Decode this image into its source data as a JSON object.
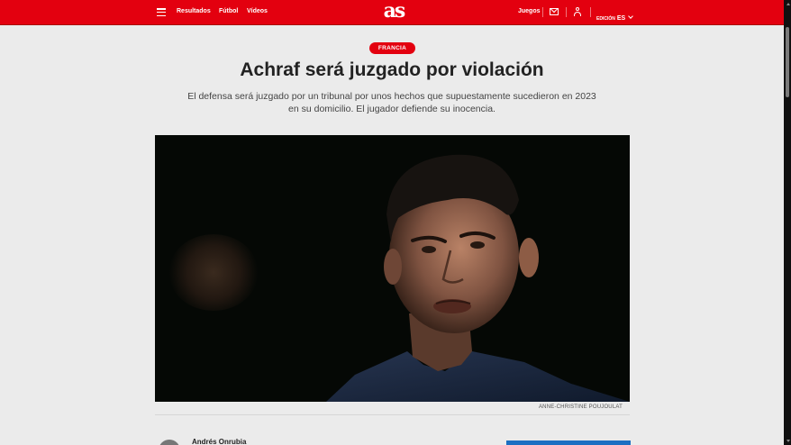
{
  "header": {
    "logo": "as",
    "nav": [
      "Resultados",
      "Fútbol",
      "Vídeos"
    ],
    "games": "Juegos",
    "edition_label": "EDICIÓN",
    "edition_value": "ES",
    "icons": [
      "menu-icon",
      "mail-icon",
      "user-icon",
      "chevron-down-icon"
    ]
  },
  "article": {
    "category": "FRANCIA",
    "title": "Achraf será juzgado por violación",
    "subtitle": "El defensa será juzgado por un tribunal por unos hechos que supuestamente sucedieron en 2023 en su domicilio. El jugador defiende su inocencia.",
    "photo_credit": "ANNE-CHRISTINE POUJOULAT",
    "author": "Andrés Onrubia"
  },
  "colors": {
    "brand": "#e3000f",
    "background": "#ebebeb",
    "headline": "#222222",
    "ad": "#1c6fc2"
  }
}
